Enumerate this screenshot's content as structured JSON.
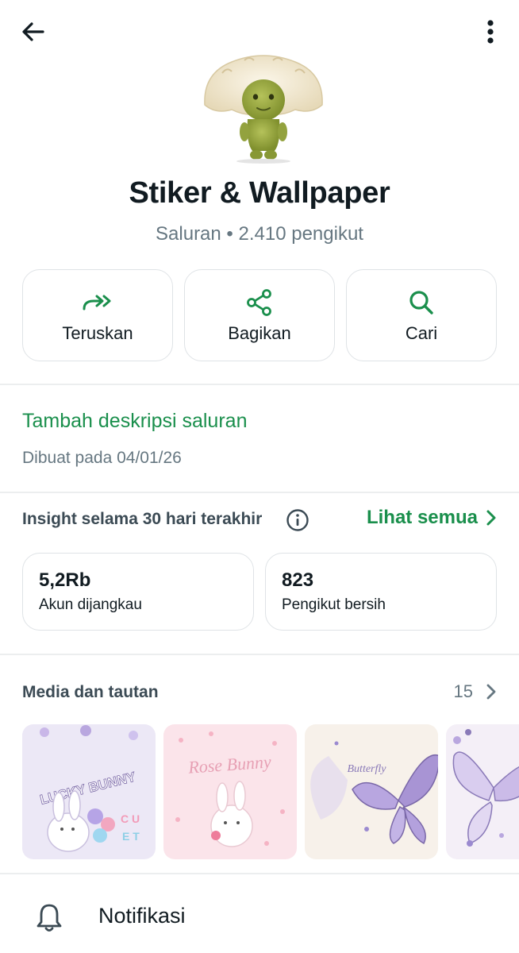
{
  "header": {
    "back_icon": "arrow-left-icon",
    "menu_icon": "more-vertical-icon"
  },
  "channel": {
    "name": "Stiker & Wallpaper",
    "subtitle": "Saluran • 2.410 pengikut"
  },
  "actions": [
    {
      "label": "Teruskan",
      "icon": "forward-icon"
    },
    {
      "label": "Bagikan",
      "icon": "share-icon"
    },
    {
      "label": "Cari",
      "icon": "search-icon"
    }
  ],
  "description": {
    "add_label": "Tambah deskripsi saluran",
    "created": "Dibuat pada 04/01/26"
  },
  "insights": {
    "title": "Insight selama 30 hari terakhir",
    "see_all": "Lihat semua",
    "stats": [
      {
        "value": "5,2Rb",
        "label": "Akun dijangkau"
      },
      {
        "value": "823",
        "label": "Pengikut bersih"
      }
    ]
  },
  "media": {
    "title": "Media dan tautan",
    "count": "15",
    "thumbnails": [
      {
        "name": "lucky-bunny-wallpaper",
        "text": "LUCKY BUNNY"
      },
      {
        "name": "rose-bunny-wallpaper",
        "text": "Rose Bunny"
      },
      {
        "name": "butterfly-wallpaper",
        "text": "Butterfly"
      },
      {
        "name": "butterfly-wallpaper-2",
        "text": ""
      }
    ]
  },
  "notifications": {
    "label": "Notifikasi",
    "icon": "bell-icon"
  },
  "colors": {
    "accent": "#1a8f4c",
    "text_primary": "#111b21",
    "text_secondary": "#667781",
    "border": "#dfe3e6"
  }
}
